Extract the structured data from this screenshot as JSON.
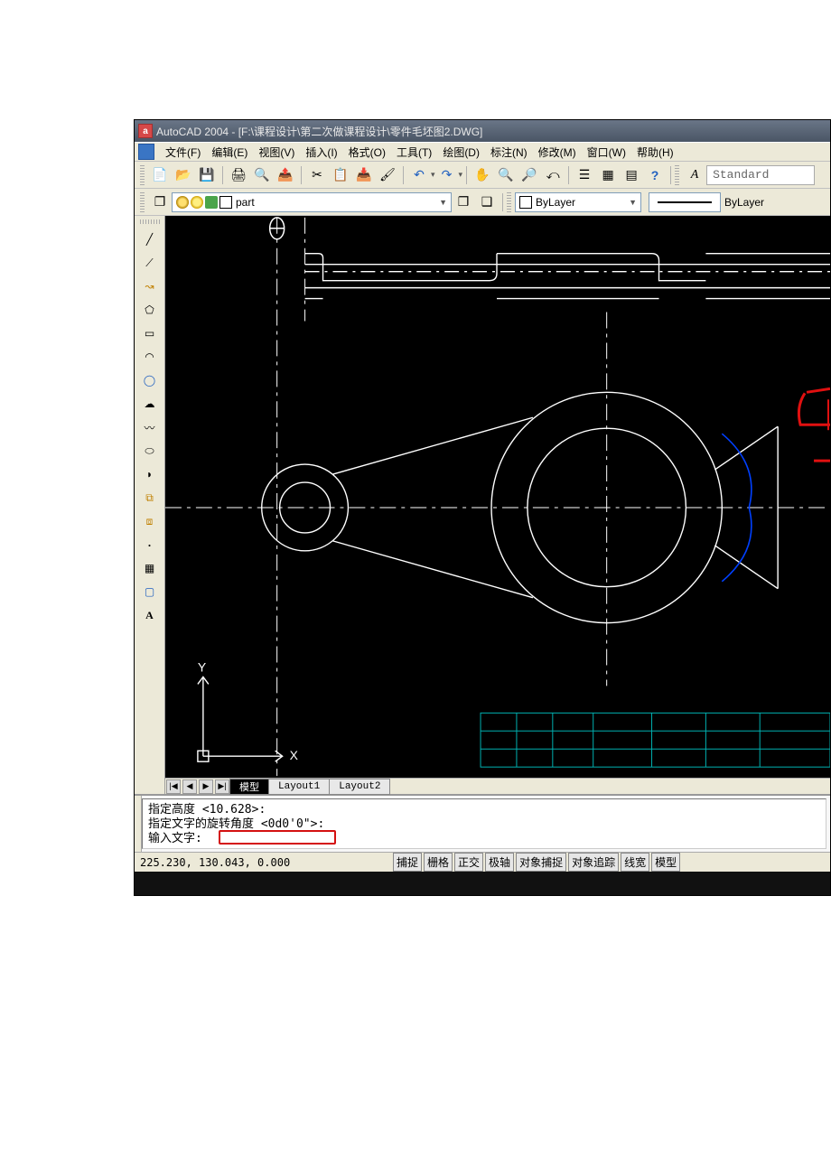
{
  "title": "AutoCAD 2004 - [F:\\课程设计\\第二次做课程设计\\零件毛坯图2.DWG]",
  "menu": {
    "items": [
      "文件(F)",
      "编辑(E)",
      "视图(V)",
      "插入(I)",
      "格式(O)",
      "工具(T)",
      "绘图(D)",
      "标注(N)",
      "修改(M)",
      "窗口(W)",
      "帮助(H)"
    ]
  },
  "toolbar1": {
    "icons": [
      "new-doc",
      "open",
      "save",
      "print",
      "preview",
      "publish",
      "cut",
      "copy",
      "paste",
      "match",
      "undo",
      "redo",
      "sep",
      "pan",
      "zoom-rt",
      "zoom-win",
      "zoom-prev",
      "properties",
      "dcenter",
      "tool-pal",
      "help"
    ]
  },
  "toolbar_style": {
    "label": "Standard"
  },
  "layer_row": {
    "layer_name": "part",
    "color_bylayer": "ByLayer",
    "line_bylayer": "ByLayer"
  },
  "draw_tools": [
    "line",
    "ray",
    "pline",
    "polygon",
    "rectangle",
    "arc",
    "circle",
    "revcloud",
    "spline",
    "ellipse",
    "ellipse-arc",
    "insert",
    "mblock",
    "point",
    "hatch",
    "region",
    "text"
  ],
  "draw_tool_glyphs": {
    "line": "╱",
    "ray": "⟋",
    "pline": "↝",
    "polygon": "⬠",
    "rectangle": "▭",
    "arc": "◠",
    "circle": "◯",
    "revcloud": "☁",
    "spline": "〰",
    "ellipse": "⬭",
    "ellipse-arc": "◗",
    "insert": "⧉",
    "mblock": "⧈",
    "point": "·",
    "hatch": "▦",
    "region": "▢",
    "text": "A"
  },
  "tabs": {
    "nav": [
      "|◀",
      "◀",
      "▶",
      "▶|"
    ],
    "items": [
      "模型",
      "Layout1",
      "Layout2"
    ],
    "active_index": 0
  },
  "command": {
    "line1": "指定高度 <10.628>:",
    "line2": "指定文字的旋转角度 <0d0'0\">:",
    "line3_prompt": "输入文字: "
  },
  "status": {
    "coords": "225.230, 130.043, 0.000",
    "toggles": [
      "捕捉",
      "栅格",
      "正交",
      "极轴",
      "对象捕捉",
      "对象追踪",
      "线宽",
      "模型"
    ]
  },
  "ucs": {
    "x": "X",
    "y": "Y"
  }
}
